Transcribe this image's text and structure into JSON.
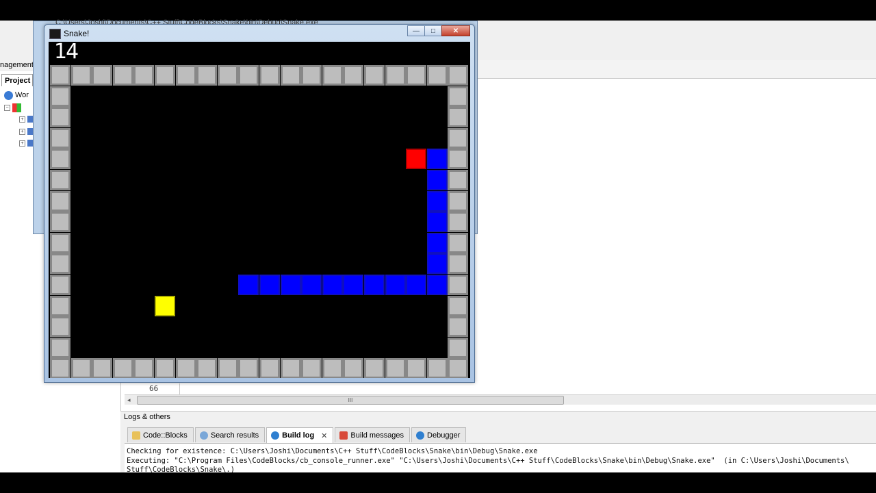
{
  "ide": {
    "management_label": "nagement",
    "projects_tab": "Project",
    "workspace_label": "Wor",
    "line_number": "66",
    "scroll_grip": "III",
    "logs_title": "Logs & others",
    "log_tabs": [
      {
        "label": "Code::Blocks",
        "icon": "note-icon",
        "active": false
      },
      {
        "label": "Search results",
        "icon": "search-icon",
        "active": false
      },
      {
        "label": "Build log",
        "icon": "gear-icon",
        "active": true
      },
      {
        "label": "Build messages",
        "icon": "pin-icon",
        "active": false
      },
      {
        "label": "Debugger",
        "icon": "gear-icon",
        "active": false
      }
    ],
    "log_lines": [
      "Checking for existence: C:\\Users\\Joshi\\Documents\\C++ Stuff\\CodeBlocks\\Snake\\bin\\Debug\\Snake.exe",
      "Executing: \"C:\\Program Files\\CodeBlocks/cb_console_runner.exe\" \"C:\\Users\\Joshi\\Documents\\C++ Stuff\\CodeBlocks\\Snake\\bin\\Debug\\Snake.exe\"  (in C:\\Users\\Joshi\\Documents\\",
      "Stuff\\CodeBlocks\\Snake\\.)"
    ],
    "console_path": "C:\\Users\\Joshi\\Documents\\C++ Stuff\\CodeBlocks\\Snake\\bin\\Debug\\Snake.exe"
  },
  "window": {
    "title": "Snake!",
    "minimize": "—",
    "maximize": "□",
    "close": "✕"
  },
  "game": {
    "score": "14",
    "grid_cols": 20,
    "grid_rows": 15,
    "colors": {
      "wall": "#bdbdbd",
      "snake": "#0000ff",
      "apple": "#ff0000",
      "food": "#ffff00",
      "background": "#000000"
    },
    "snake": [
      [
        9,
        10
      ],
      [
        10,
        10
      ],
      [
        11,
        10
      ],
      [
        12,
        10
      ],
      [
        13,
        10
      ],
      [
        14,
        10
      ],
      [
        15,
        10
      ],
      [
        16,
        10
      ],
      [
        17,
        10
      ],
      [
        18,
        10
      ],
      [
        18,
        9
      ],
      [
        18,
        8
      ],
      [
        18,
        7
      ],
      [
        18,
        6
      ],
      [
        18,
        5
      ],
      [
        18,
        4
      ]
    ],
    "apple": [
      17,
      4
    ],
    "food": [
      5,
      11
    ]
  }
}
